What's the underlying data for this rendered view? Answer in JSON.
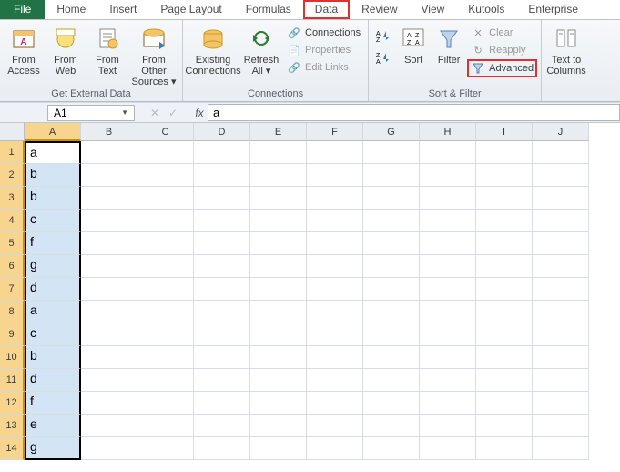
{
  "tabs": {
    "file": "File",
    "home": "Home",
    "insert": "Insert",
    "page_layout": "Page Layout",
    "formulas": "Formulas",
    "data": "Data",
    "review": "Review",
    "view": "View",
    "kutools": "Kutools",
    "enterprise": "Enterprise"
  },
  "ribbon": {
    "get_external": {
      "label": "Get External Data",
      "from_access": "From\nAccess",
      "from_web": "From\nWeb",
      "from_text": "From\nText",
      "from_other": "From Other\nSources ▾"
    },
    "connections": {
      "label": "Connections",
      "existing": "Existing\nConnections",
      "refresh": "Refresh\nAll ▾",
      "conn": "Connections",
      "props": "Properties",
      "editlinks": "Edit Links"
    },
    "sortfilter": {
      "label": "Sort & Filter",
      "sort": "Sort",
      "filter": "Filter",
      "clear": "Clear",
      "reapply": "Reapply",
      "advanced": "Advanced"
    },
    "datatools": {
      "texttocol": "Text to\nColumns"
    }
  },
  "namebox": "A1",
  "formula": "a",
  "columns": [
    "A",
    "B",
    "C",
    "D",
    "E",
    "F",
    "G",
    "H",
    "I",
    "J"
  ],
  "rows": [
    {
      "n": 1,
      "v": "a"
    },
    {
      "n": 2,
      "v": "b"
    },
    {
      "n": 3,
      "v": "b"
    },
    {
      "n": 4,
      "v": "c"
    },
    {
      "n": 5,
      "v": "f"
    },
    {
      "n": 6,
      "v": "g"
    },
    {
      "n": 7,
      "v": "d"
    },
    {
      "n": 8,
      "v": "a"
    },
    {
      "n": 9,
      "v": "c"
    },
    {
      "n": 10,
      "v": "b"
    },
    {
      "n": 11,
      "v": "d"
    },
    {
      "n": 12,
      "v": "f"
    },
    {
      "n": 13,
      "v": "e"
    },
    {
      "n": 14,
      "v": "g"
    }
  ]
}
